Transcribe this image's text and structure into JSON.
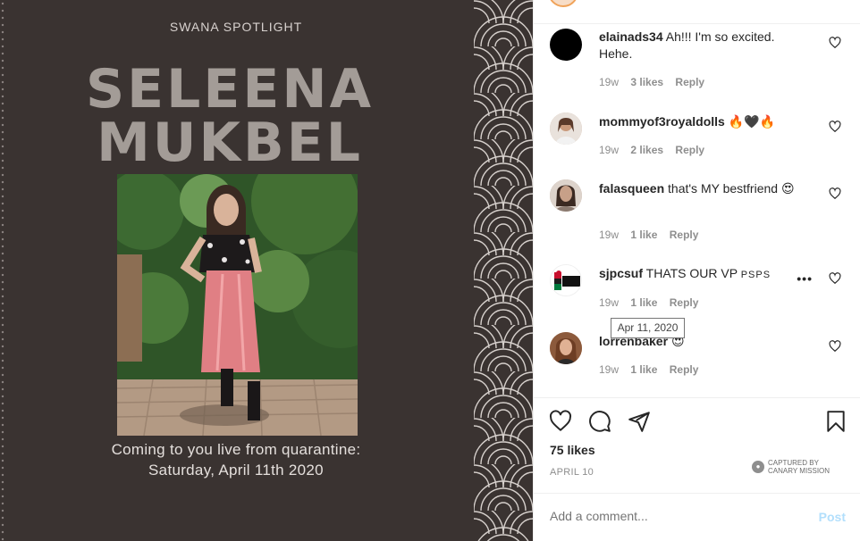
{
  "post": {
    "label": "SWANA SPOTLIGHT",
    "name_line_1": "SELEENA",
    "name_line_2": "MUKBEL",
    "caption_line_1": "Coming to you live from quarantine:",
    "caption_line_2": "Saturday, April 11th 2020",
    "background_color": "#3a3331"
  },
  "comments": [
    {
      "username": "elainads34",
      "text": "Ah!!! I'm so excited. Hehe.",
      "age": "19w",
      "likes": "3 likes",
      "reply": "Reply"
    },
    {
      "username": "mommyof3royaldolls",
      "text": "🔥🖤🔥",
      "age": "19w",
      "likes": "2 likes",
      "reply": "Reply"
    },
    {
      "username": "falasqueen",
      "text": "that's MY bestfriend 😍",
      "age": "19w",
      "likes": "1 like",
      "reply": "Reply"
    },
    {
      "username": "sjpcsuf",
      "text": "THATS OUR VP",
      "text_small": "PSPS",
      "age": "19w",
      "likes": "1 like",
      "reply": "Reply",
      "more_label": "•••"
    },
    {
      "username": "lorrenbaker",
      "text": "😍",
      "age": "19w",
      "likes": "1 like",
      "reply": "Reply"
    }
  ],
  "tooltip": "Apr 11, 2020",
  "footer": {
    "likes": "75 likes",
    "date": "APRIL 10",
    "watermark_line_1": "CAPTURED BY",
    "watermark_line_2": "CANARY MISSION",
    "add_comment_placeholder": "Add a comment...",
    "post_label": "Post"
  },
  "icons": [
    "heart-icon",
    "comment-icon",
    "share-icon",
    "bookmark-icon"
  ],
  "colors": {
    "post_button": "#b2dffc",
    "meta_text": "#8e8e8e",
    "name_text": "#a39c97"
  }
}
